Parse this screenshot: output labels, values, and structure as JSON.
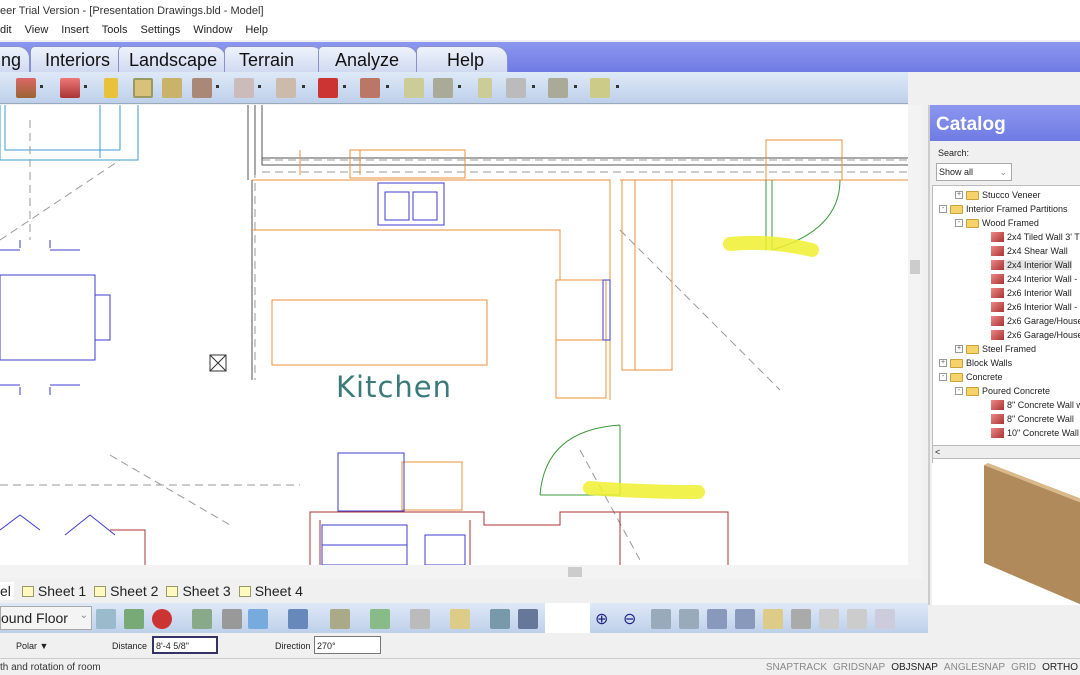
{
  "window": {
    "title": "eer Trial Version - [Presentation Drawings.bld - Model]"
  },
  "menu": [
    "dit",
    "View",
    "Insert",
    "Tools",
    "Settings",
    "Window",
    "Help"
  ],
  "tabs": [
    "ng",
    "Interiors",
    "Landscape",
    "Terrain",
    "Analyze",
    "Help"
  ],
  "drawing": {
    "room_label": "Kitchen"
  },
  "sheets": [
    "el",
    "Sheet 1",
    "Sheet 2",
    "Sheet 3",
    "Sheet 4"
  ],
  "floor_select": "ound Floor",
  "inputs": {
    "mode": "Polar ▼",
    "distance_label": "Distance",
    "distance_value": "8'-4 5/8\"",
    "direction_label": "Direction",
    "direction_value": "270°"
  },
  "status": {
    "message": "th and rotation of room",
    "toggles": [
      "SNAPTRACK",
      "GRIDSNAP",
      "OBJSNAP",
      "ANGLESNAP",
      "GRID",
      "ORTHO"
    ]
  },
  "catalog": {
    "title": "Catalog",
    "search_label": "Search:",
    "filter": "Show all",
    "tree": [
      {
        "label": "Stucco Veneer",
        "level": 1,
        "type": "folder",
        "exp": "+"
      },
      {
        "label": "Interior Framed Partitions",
        "level": 0,
        "type": "folder",
        "exp": "-"
      },
      {
        "label": "Wood Framed",
        "level": 1,
        "type": "folder",
        "exp": "-"
      },
      {
        "label": "2x4 Tiled Wall 3' T",
        "level": 2,
        "type": "wall"
      },
      {
        "label": "2x4 Shear Wall",
        "level": 2,
        "type": "wall"
      },
      {
        "label": "2x4 Interior Wall",
        "level": 2,
        "type": "wall",
        "selected": true
      },
      {
        "label": "2x4 Interior Wall -",
        "level": 2,
        "type": "wall"
      },
      {
        "label": "2x6 Interior Wall",
        "level": 2,
        "type": "wall"
      },
      {
        "label": "2x6 Interior Wall -",
        "level": 2,
        "type": "wall"
      },
      {
        "label": "2x6 Garage/House",
        "level": 2,
        "type": "wall"
      },
      {
        "label": "2x6 Garage/House",
        "level": 2,
        "type": "wall"
      },
      {
        "label": "Steel Framed",
        "level": 1,
        "type": "folder",
        "exp": "+"
      },
      {
        "label": "Block Walls",
        "level": 0,
        "type": "folder",
        "exp": "+"
      },
      {
        "label": "Concrete",
        "level": 0,
        "type": "folder",
        "exp": "-"
      },
      {
        "label": "Poured Concrete",
        "level": 1,
        "type": "folder",
        "exp": "-"
      },
      {
        "label": "8\" Concrete Wall w",
        "level": 2,
        "type": "wall"
      },
      {
        "label": "8\" Concrete Wall",
        "level": 2,
        "type": "wall"
      },
      {
        "label": "10\" Concrete Wall",
        "level": 2,
        "type": "wall"
      }
    ]
  },
  "colors": {
    "tab_bar": "#7b86e8",
    "toolbar": "#cfdcef",
    "walls": "#e8913a",
    "furniture": "#3b3bd0",
    "highlight": "#f2f23a",
    "label": "#3a7a7a"
  }
}
